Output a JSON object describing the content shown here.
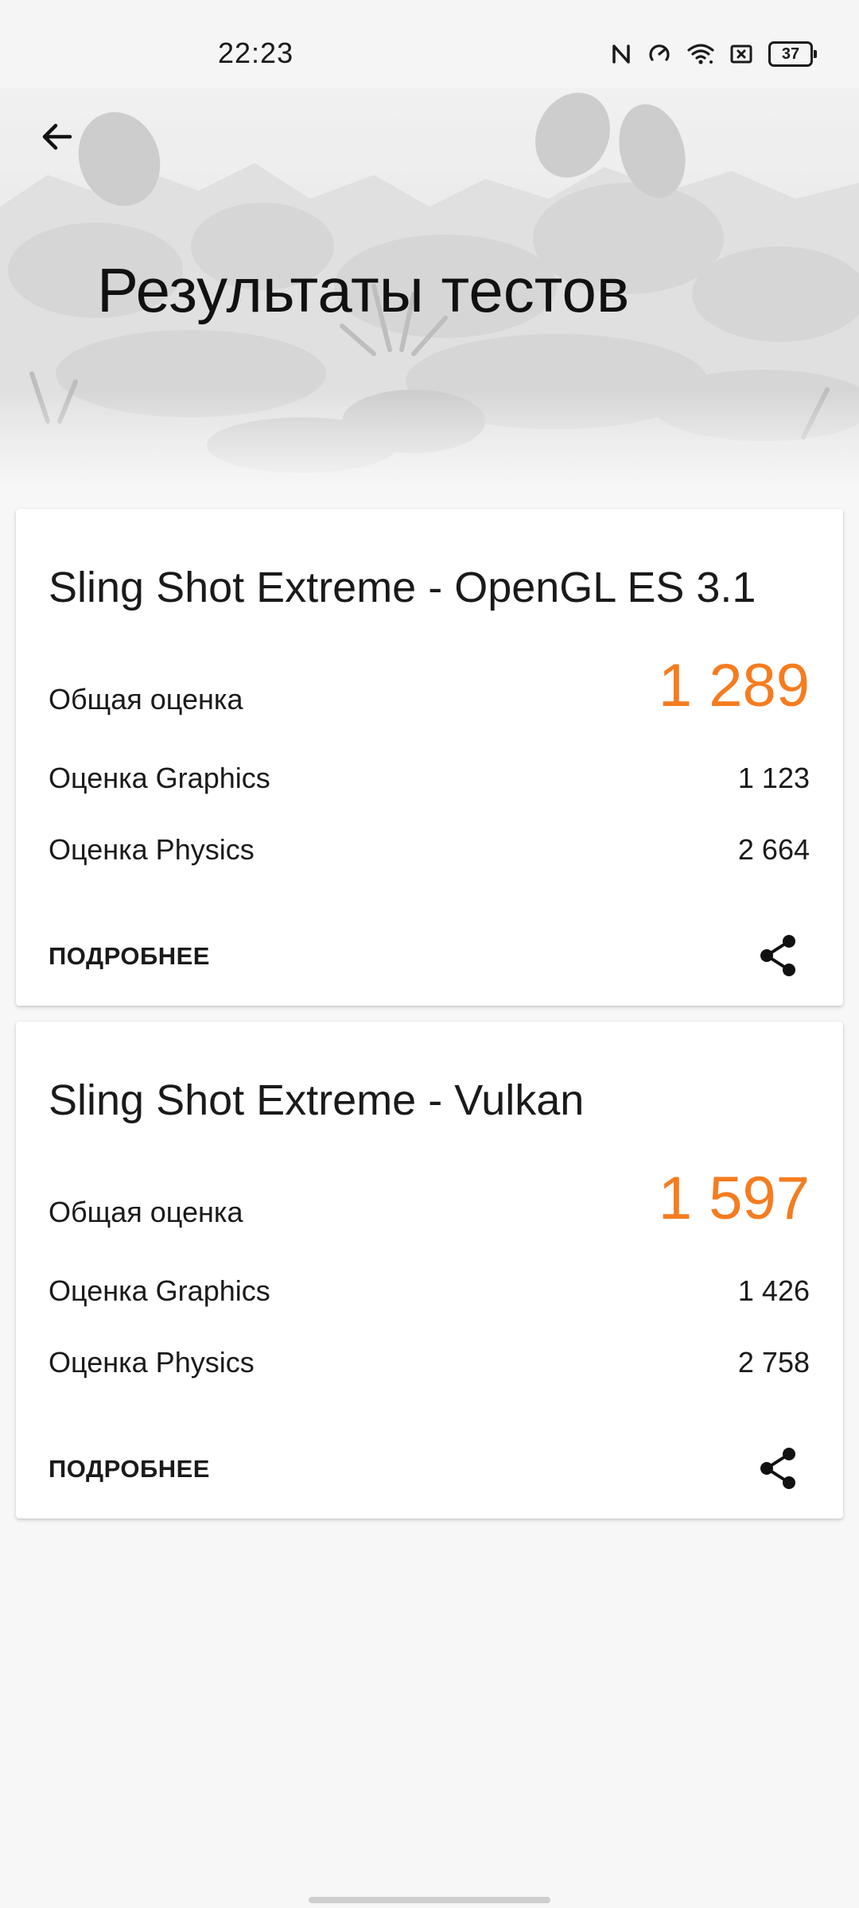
{
  "status_bar": {
    "time": "22:23",
    "battery": "37",
    "icons": [
      "nfc-icon",
      "data-saver-icon",
      "wifi-icon",
      "sim-icon",
      "battery-icon"
    ]
  },
  "header": {
    "title": "Результаты тестов",
    "back_icon": "arrow-left-icon"
  },
  "accent_color": "#f57c1f",
  "results": [
    {
      "title": "Sling Shot Extreme - OpenGL ES 3.1",
      "total_label": "Общая оценка",
      "total_value": "1 289",
      "graphics_label": "Оценка Graphics",
      "graphics_value": "1 123",
      "physics_label": "Оценка Physics",
      "physics_value": "2 664",
      "details_label": "ПОДРОБНЕЕ",
      "share_icon": "share-icon"
    },
    {
      "title": "Sling Shot Extreme - Vulkan",
      "total_label": "Общая оценка",
      "total_value": "1 597",
      "graphics_label": "Оценка Graphics",
      "graphics_value": "1 426",
      "physics_label": "Оценка Physics",
      "physics_value": "2 758",
      "details_label": "ПОДРОБНЕЕ",
      "share_icon": "share-icon"
    }
  ]
}
